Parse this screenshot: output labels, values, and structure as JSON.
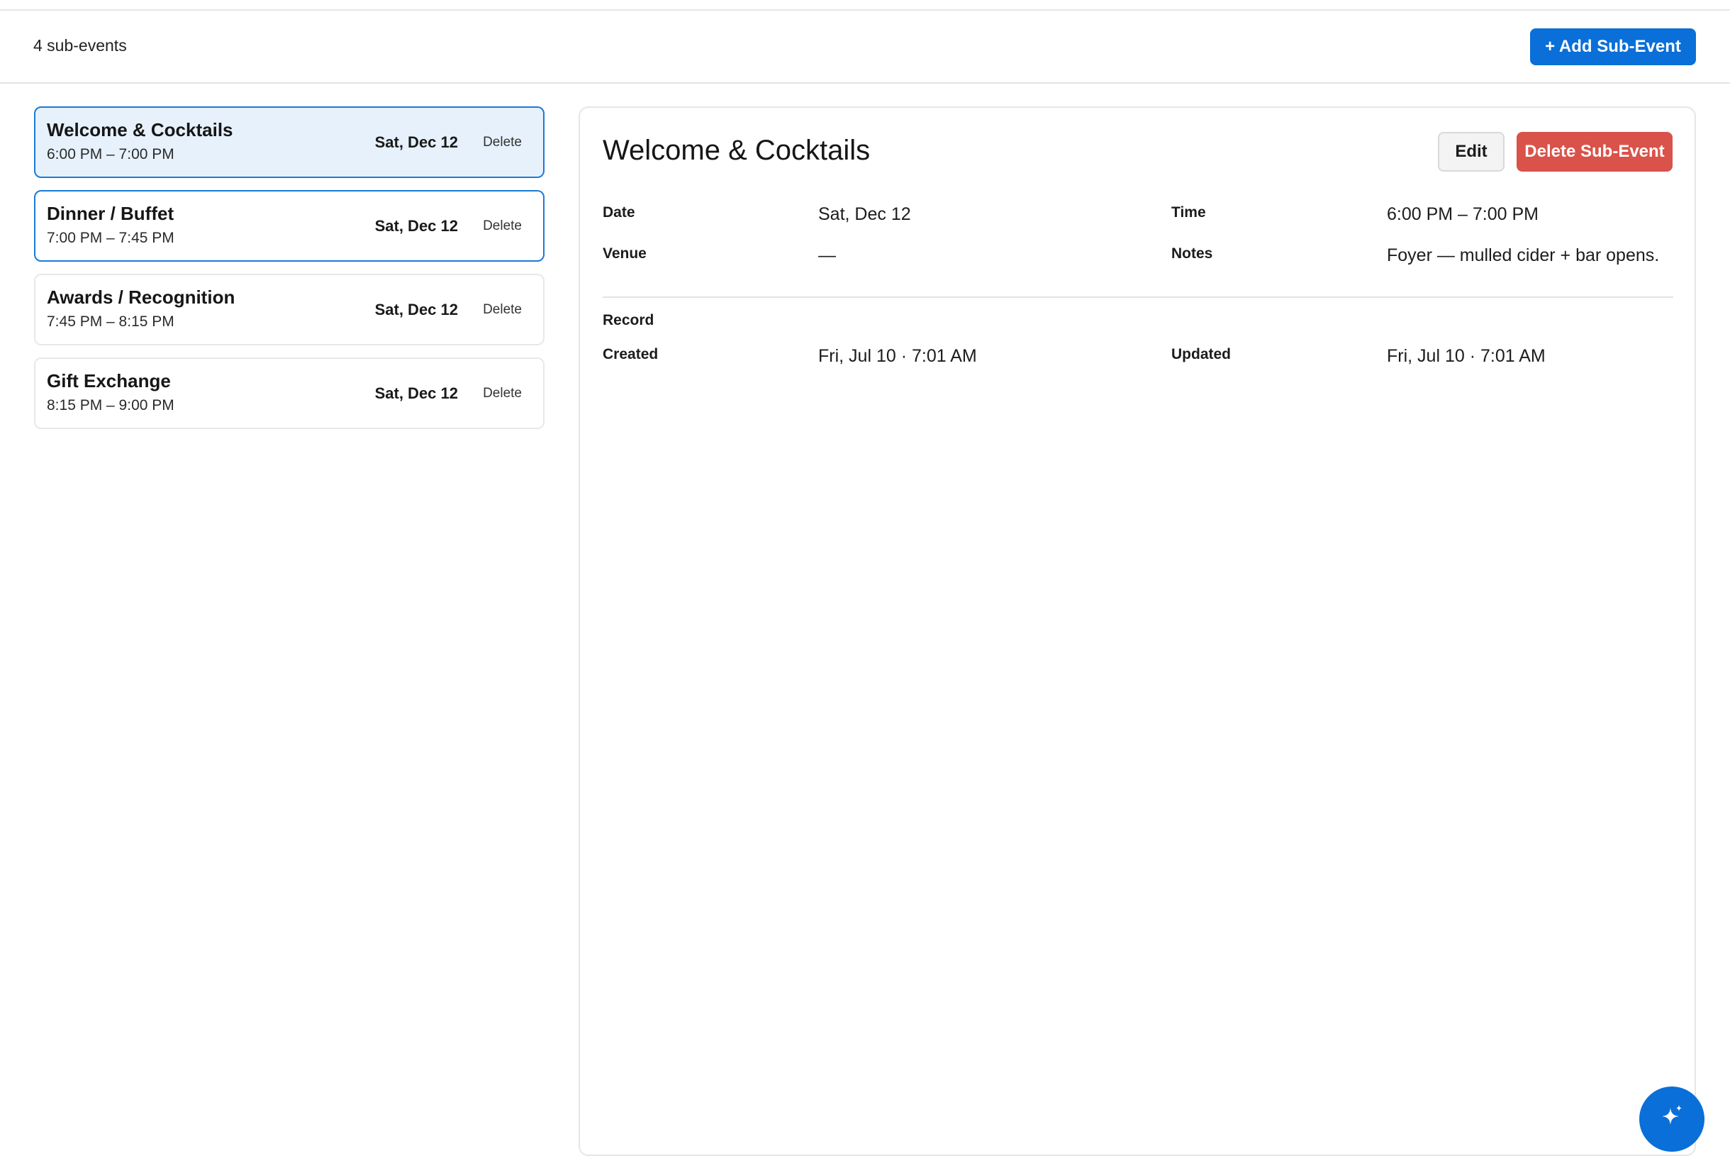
{
  "toolbar": {
    "count_label": "4 sub-events",
    "add_button_label": "+ Add Sub-Event"
  },
  "sub_events": [
    {
      "title": "Welcome & Cocktails",
      "time": "6:00 PM – 7:00 PM",
      "date": "Sat, Dec 12",
      "delete_label": "Delete",
      "state": "selected"
    },
    {
      "title": "Dinner / Buffet",
      "time": "7:00 PM – 7:45 PM",
      "date": "Sat, Dec 12",
      "delete_label": "Delete",
      "state": "hovered"
    },
    {
      "title": "Awards / Recognition",
      "time": "7:45 PM – 8:15 PM",
      "date": "Sat, Dec 12",
      "delete_label": "Delete",
      "state": "normal"
    },
    {
      "title": "Gift Exchange",
      "time": "8:15 PM – 9:00 PM",
      "date": "Sat, Dec 12",
      "delete_label": "Delete",
      "state": "normal"
    }
  ],
  "detail": {
    "title": "Welcome & Cocktails",
    "edit_label": "Edit",
    "delete_label": "Delete Sub-Event",
    "fields": {
      "date_label": "Date",
      "date_value": "Sat, Dec 12",
      "time_label": "Time",
      "time_value": "6:00 PM – 7:00 PM",
      "venue_label": "Venue",
      "venue_value": "—",
      "notes_label": "Notes",
      "notes_value": "Foyer — mulled cider + bar opens."
    },
    "record": {
      "section_label": "Record",
      "created_label": "Created",
      "created_value": "Fri, Jul 10 · 7:01 AM",
      "updated_label": "Updated",
      "updated_value": "Fri, Jul 10 · 7:01 AM"
    }
  },
  "fab": {
    "icon": "sparkle-icon"
  },
  "colors": {
    "primary": "#0a6fd8",
    "danger": "#d9534a",
    "selected_bg": "#e6f1fc",
    "selected_border": "#1a7ad6"
  }
}
